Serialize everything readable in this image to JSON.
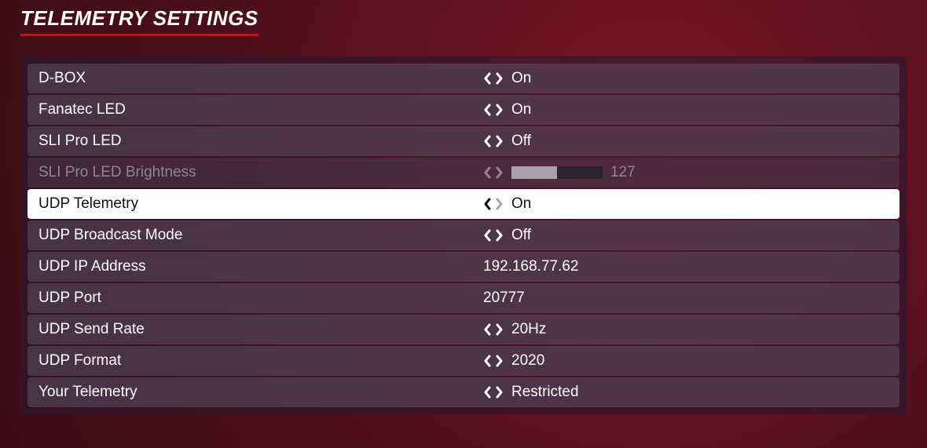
{
  "title": "TELEMETRY SETTINGS",
  "rows": [
    {
      "label": "D-BOX",
      "value": "On",
      "arrows": true,
      "state": "normal",
      "type": "toggle"
    },
    {
      "label": "Fanatec LED",
      "value": "On",
      "arrows": true,
      "state": "normal",
      "type": "toggle"
    },
    {
      "label": "SLI Pro LED",
      "value": "Off",
      "arrows": true,
      "state": "normal",
      "type": "toggle"
    },
    {
      "label": "SLI Pro LED Brightness",
      "value": "127",
      "arrows": true,
      "state": "disabled",
      "type": "slider",
      "slider_pct": 50
    },
    {
      "label": "UDP Telemetry",
      "value": "On",
      "arrows": true,
      "state": "selected",
      "type": "toggle"
    },
    {
      "label": "UDP Broadcast Mode",
      "value": "Off",
      "arrows": true,
      "state": "normal",
      "type": "toggle"
    },
    {
      "label": "UDP IP Address",
      "value": "192.168.77.62",
      "arrows": false,
      "state": "normal",
      "type": "text"
    },
    {
      "label": "UDP Port",
      "value": "20777",
      "arrows": false,
      "state": "normal",
      "type": "text"
    },
    {
      "label": "UDP Send Rate",
      "value": "20Hz",
      "arrows": true,
      "state": "normal",
      "type": "toggle"
    },
    {
      "label": "UDP Format",
      "value": "2020",
      "arrows": true,
      "state": "normal",
      "type": "toggle"
    },
    {
      "label": "Your Telemetry",
      "value": "Restricted",
      "arrows": true,
      "state": "normal",
      "type": "toggle"
    }
  ]
}
